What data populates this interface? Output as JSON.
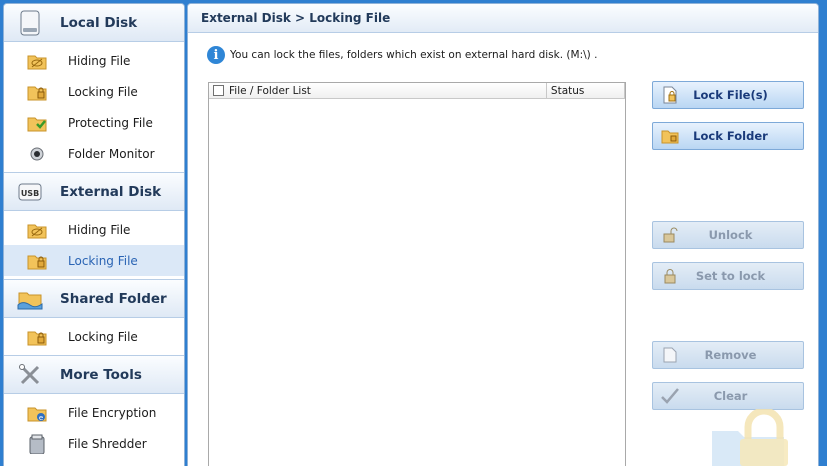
{
  "sidebar": {
    "sections": [
      {
        "title": "Local Disk",
        "icon": "hard-disk-icon",
        "items": [
          {
            "label": "Hiding File",
            "icon": "hide-folder-icon"
          },
          {
            "label": "Locking File",
            "icon": "lock-folder-icon"
          },
          {
            "label": "Protecting File",
            "icon": "protect-folder-icon"
          },
          {
            "label": "Folder Monitor",
            "icon": "monitor-icon"
          }
        ]
      },
      {
        "title": "External Disk",
        "icon": "usb-icon",
        "icon_text": "USB",
        "items": [
          {
            "label": "Hiding File",
            "icon": "hide-folder-icon"
          },
          {
            "label": "Locking File",
            "icon": "lock-folder-icon",
            "active": true
          }
        ]
      },
      {
        "title": "Shared Folder",
        "icon": "shared-folder-icon",
        "items": [
          {
            "label": "Locking File",
            "icon": "lock-folder-icon"
          }
        ]
      },
      {
        "title": "More Tools",
        "icon": "tools-icon",
        "items": [
          {
            "label": "File Encryption",
            "icon": "encryption-icon"
          },
          {
            "label": "File Shredder",
            "icon": "shredder-icon"
          }
        ]
      }
    ]
  },
  "main": {
    "breadcrumb": "External Disk > Locking File",
    "info_text": "You can lock the files, folders which exist on external hard disk. (M:\\) .",
    "list": {
      "columns": [
        "File / Folder List",
        "Status"
      ],
      "rows": []
    },
    "buttons": {
      "lock_files": "Lock File(s)",
      "lock_folder": "Lock Folder",
      "unlock": "Unlock",
      "set_to_lock": "Set to lock",
      "remove": "Remove",
      "clear": "Clear"
    }
  },
  "colors": {
    "frame": "#2f7fd0",
    "active_item_bg": "#dbe8f7",
    "active_item_text": "#2a64b4",
    "button_text": "#1a3a7a",
    "disabled_text": "#8a99ad"
  }
}
